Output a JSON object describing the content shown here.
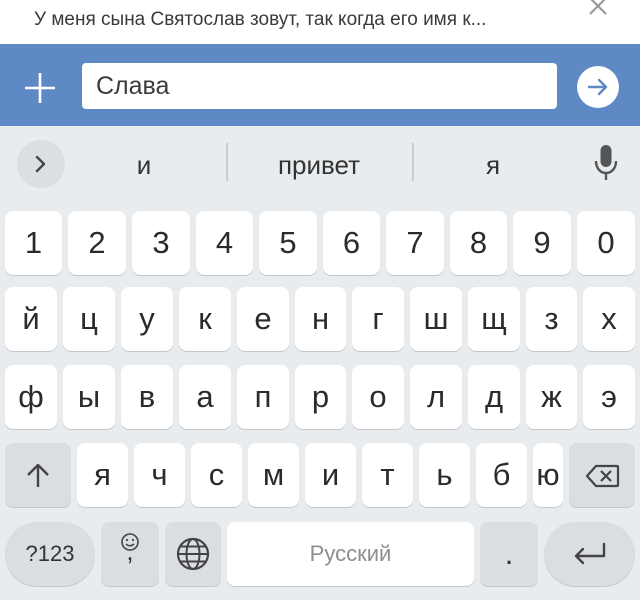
{
  "reply": {
    "text": "У меня сына Святослав зовут, так когда его имя к..."
  },
  "input": {
    "value": "Слава"
  },
  "suggestions": [
    "и",
    "привет",
    "я"
  ],
  "keyboard": {
    "row_numbers": [
      "1",
      "2",
      "3",
      "4",
      "5",
      "6",
      "7",
      "8",
      "9",
      "0"
    ],
    "row1": [
      "й",
      "ц",
      "у",
      "к",
      "е",
      "н",
      "г",
      "ш",
      "щ",
      "з",
      "х"
    ],
    "row2": [
      "ф",
      "ы",
      "в",
      "а",
      "п",
      "р",
      "о",
      "л",
      "д",
      "ж",
      "э"
    ],
    "row3": [
      "я",
      "ч",
      "с",
      "м",
      "и",
      "т",
      "ь",
      "б",
      "ю"
    ],
    "symbols_label": "?123",
    "comma_label": ",",
    "space_label": "Русский",
    "period_label": "."
  },
  "colors": {
    "input_bar": "#5e89c4",
    "keyboard_bg": "#e9ecee",
    "send_arrow": "#5e89c4"
  },
  "icons": [
    "close-icon",
    "plus-icon",
    "send-arrow-icon",
    "chevron-right-icon",
    "microphone-icon",
    "shift-icon",
    "backspace-icon",
    "emoji-icon",
    "globe-icon",
    "enter-icon"
  ]
}
